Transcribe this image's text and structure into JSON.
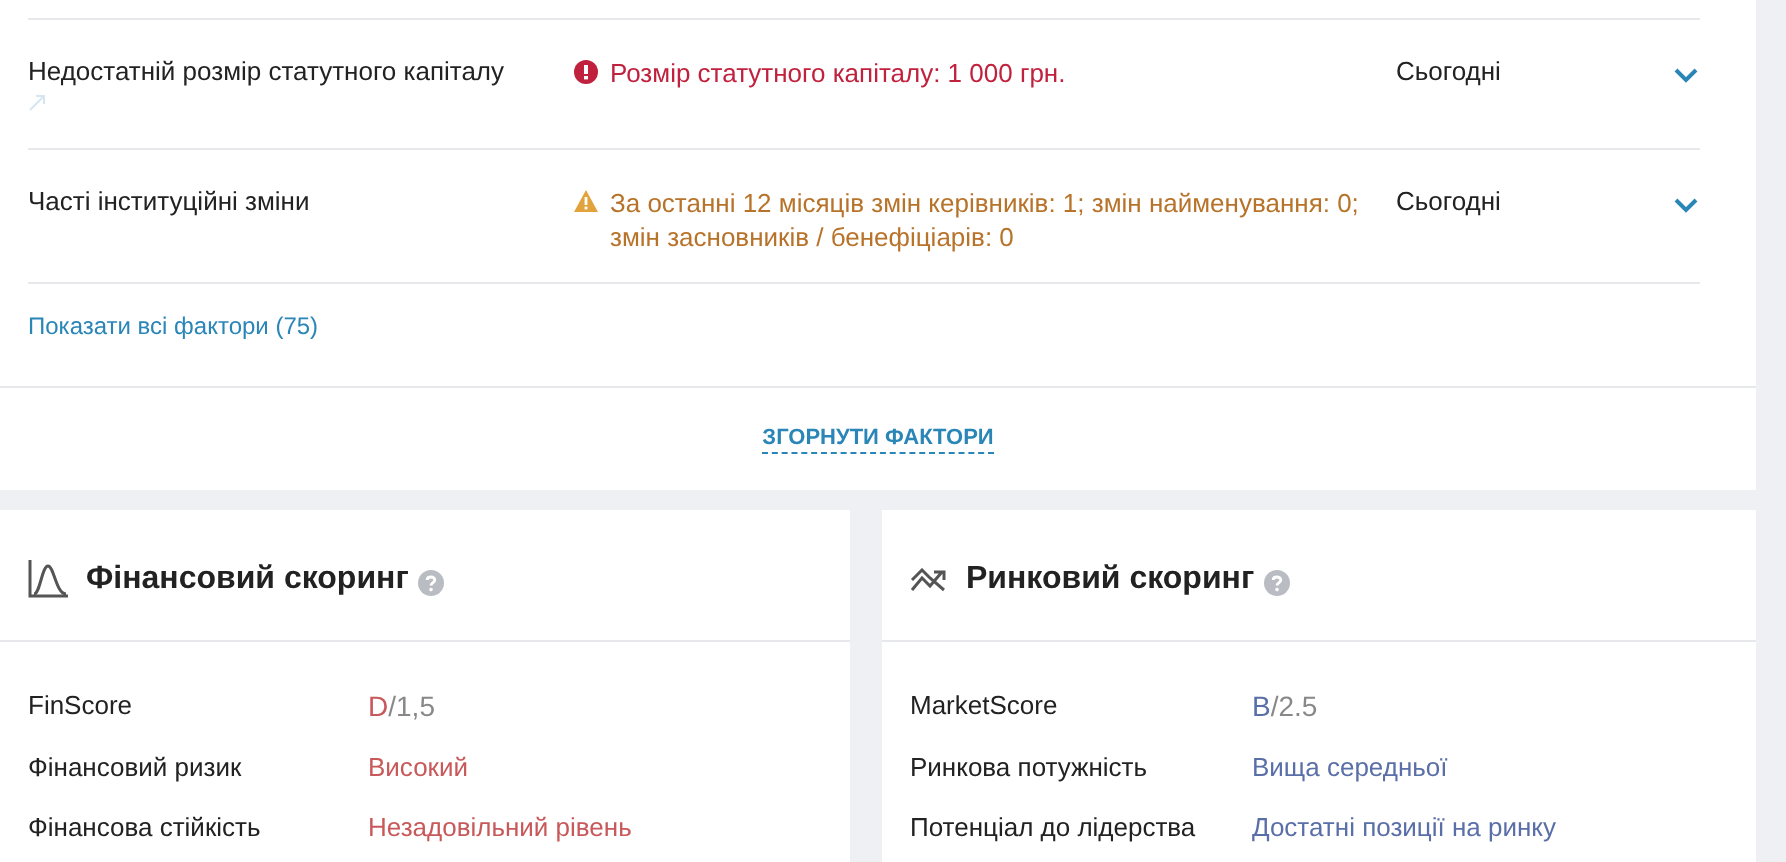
{
  "factors": [
    {
      "name": "Недостатній розмір статутного капіталу",
      "kind": "error",
      "message": "Розмір статутного капіталу: 1 000 грн.",
      "date": "Сьогодні",
      "expanded": false,
      "linked": true
    },
    {
      "name": "Часті інституційні зміни",
      "kind": "warning",
      "message": "За останні 12 місяців змін керівників: 1; змін найменування: 0; змін засновників / бенефіціарів: 0",
      "date": "Сьогодні",
      "expanded": false,
      "linked": false
    }
  ],
  "show_all_link": "Показати всі фактори (75)",
  "collapse_link": "ЗГОРНУТИ ФАКТОРИ",
  "scorings": [
    {
      "title": "Фінансовий скоринг",
      "kind": "financial",
      "rows": [
        {
          "label": "FinScore",
          "grade": "D",
          "score": "/1,5",
          "color": "#c8595b"
        },
        {
          "label": "Фінансовий ризик",
          "value": "Високий",
          "color": "#c8595b"
        },
        {
          "label": "Фінансова стійкість",
          "value": "Незадовільний рівень",
          "color": "#c8595b"
        }
      ]
    },
    {
      "title": "Ринковий скоринг",
      "kind": "market",
      "rows": [
        {
          "label": "MarketScore",
          "grade": "B",
          "score": "/2.5",
          "color": "#5a6fa8"
        },
        {
          "label": "Ринкова потужність",
          "value": "Вища середньої",
          "color": "#5a6fa8"
        },
        {
          "label": "Потенціал до лідерства",
          "value": "Достатні позиції на ринку",
          "color": "#5a6fa8"
        }
      ]
    }
  ]
}
